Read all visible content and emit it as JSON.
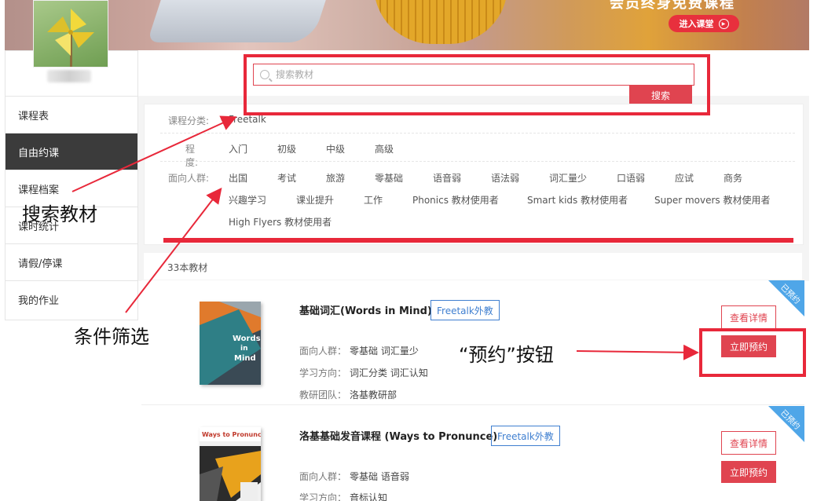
{
  "banner": {
    "slogan": "会员终身免费课程",
    "enter_label": "进入课堂"
  },
  "sidebar": {
    "items": [
      {
        "label": "课程表",
        "active": false
      },
      {
        "label": "自由约课",
        "active": true
      },
      {
        "label": "课程档案",
        "active": false
      },
      {
        "label": "课时统计",
        "active": false
      },
      {
        "label": "请假/停课",
        "active": false
      },
      {
        "label": "我的作业",
        "active": false
      }
    ]
  },
  "search": {
    "placeholder": "搜索教材",
    "button_label": "搜索"
  },
  "filters": {
    "category": {
      "label": "课程分类:",
      "options": [
        "Freetalk"
      ]
    },
    "level": {
      "label": "程度:",
      "options": [
        "入门",
        "初级",
        "中级",
        "高级"
      ]
    },
    "audience": {
      "label": "面向人群:",
      "row1": [
        "出国",
        "考试",
        "旅游",
        "零基础",
        "语音弱",
        "语法弱",
        "词汇量少",
        "口语弱",
        "应试",
        "商务"
      ],
      "row2": [
        "兴趣学习",
        "课业提升",
        "工作",
        "Phonics 教材使用者",
        "Smart kids 教材使用者",
        "Super movers 教材使用者"
      ],
      "row3": [
        "High Flyers 教材使用者"
      ]
    }
  },
  "result_count": "33本教材",
  "courses": [
    {
      "title": "基础词汇(Words in Mind)",
      "tag": "Freetalk外教",
      "audience_label": "面向人群：",
      "audience": "零基础 词汇量少",
      "direction_label": "学习方向：",
      "direction": "词汇分类 词汇认知",
      "team_label": "教研团队：",
      "team": "洛基教研部",
      "detail_label": "查看详情",
      "book_label": "立即预约",
      "ribbon": "已预约",
      "cover_text": "Words in Mind"
    },
    {
      "title": "洛基基础发音课程 (Ways to Pronunce)",
      "tag": "Freetalk外教",
      "audience_label": "面向人群：",
      "audience": "零基础 语音弱",
      "direction_label": "学习方向：",
      "direction": "音标认知",
      "detail_label": "查看详情",
      "book_label": "立即预约",
      "ribbon": "已预约",
      "cover_text": "Ways to Pronunce"
    }
  ],
  "annotations": {
    "search_note": "搜索教材",
    "filter_note": "条件筛选",
    "book_note": "“预约”按钮"
  },
  "colors": {
    "accent": "#e04450",
    "tag_blue": "#3f7fd0",
    "annotation_red": "#e8283a",
    "ribbon_blue": "#4fa6e8"
  }
}
